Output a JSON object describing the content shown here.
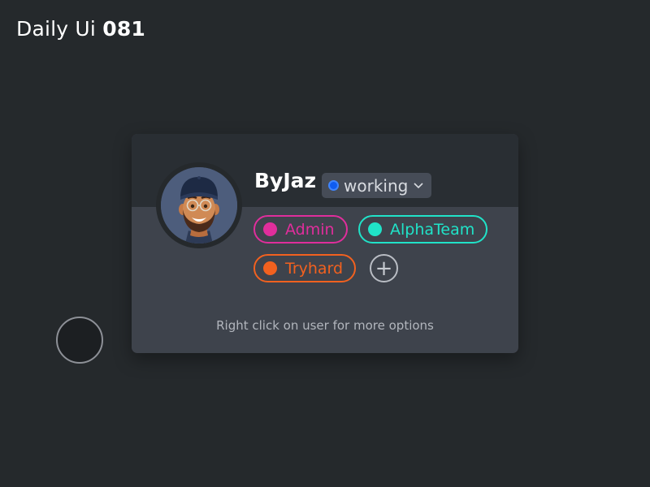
{
  "page": {
    "heading_light": "Daily Ui",
    "heading_bold": "081"
  },
  "profile": {
    "username": "ByJaz",
    "avatar_icon": "memoji-avatar",
    "status": {
      "label": "working",
      "color": "#0f5cf0",
      "chevron_icon": "chevron-down-icon"
    },
    "tags": [
      {
        "label": "Admin",
        "color": "#e02e9c"
      },
      {
        "label": "AlphaTeam",
        "color": "#20e3c8"
      },
      {
        "label": "Tryhard",
        "color": "#f2611f"
      }
    ],
    "add_tag_symbol": "+",
    "hint": "Right click on user for more options"
  },
  "colors": {
    "background": "#25292c",
    "card": "#3e434c",
    "card_header": "#292e33"
  }
}
